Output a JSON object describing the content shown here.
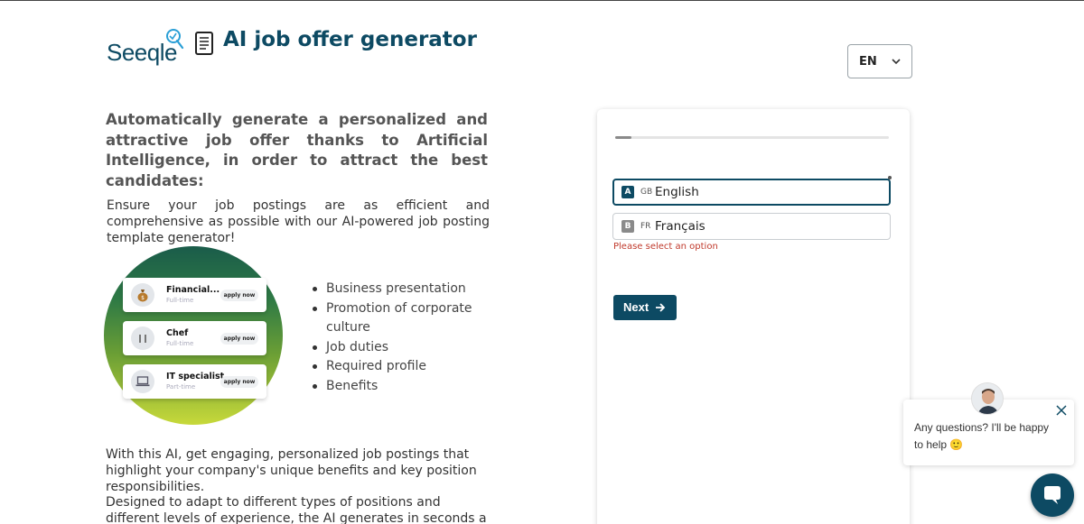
{
  "header": {
    "logo_text": "Seeqle",
    "title": "AI job offer generator",
    "language_select": {
      "value": "EN"
    }
  },
  "content": {
    "lead": "Automatically generate a personalized and attractive job offer thanks to Artificial Intelligence, in order to attract the best candidates:",
    "intro": "Ensure your job postings are as efficient and comprehensive as possible with our AI-powered job posting template generator!",
    "illustration_cards": [
      {
        "title": "Financial...",
        "type": "Full-time",
        "action": "apply now",
        "icon": "money-bag-icon"
      },
      {
        "title": "Chef",
        "type": "Full-time",
        "action": "apply now",
        "icon": "utensils-icon"
      },
      {
        "title": "IT specialist",
        "type": "Part-time",
        "action": "apply now",
        "icon": "laptop-icon"
      }
    ],
    "bullets": [
      "Business presentation",
      "Promotion of corporate culture",
      "Job duties",
      "Required profile",
      "Benefits"
    ],
    "para1": "With this AI, get engaging, personalized job postings that highlight your company's unique benefits and key position responsibilities.",
    "para2": "Designed to adapt to different types of positions and different levels of experience, the AI generates in seconds a job offer"
  },
  "form": {
    "progress": 0.06,
    "options": [
      {
        "key": "A",
        "code": "GB",
        "label": "English",
        "selected": true
      },
      {
        "key": "B",
        "code": "FR",
        "label": "Français",
        "selected": false
      }
    ],
    "error": "Please select an option",
    "next_label": "Next"
  },
  "chat": {
    "message": "Any questions? I'll be happy to help",
    "emoji": "🙂"
  },
  "colors": {
    "brand": "#0d4a63",
    "error": "#c0392b"
  }
}
